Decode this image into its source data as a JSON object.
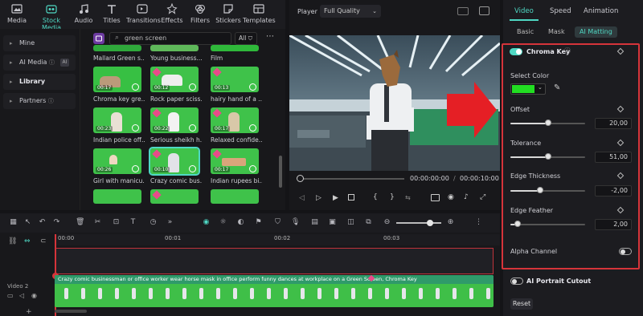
{
  "toolbar": {
    "items": [
      {
        "label": "Media",
        "icon": "media-icon"
      },
      {
        "label": "Stock Media",
        "icon": "stock-media-icon",
        "active": true
      },
      {
        "label": "Audio",
        "icon": "audio-icon"
      },
      {
        "label": "Titles",
        "icon": "titles-icon"
      },
      {
        "label": "Transitions",
        "icon": "transitions-icon"
      },
      {
        "label": "Effects",
        "icon": "effects-icon"
      },
      {
        "label": "Filters",
        "icon": "filters-icon"
      },
      {
        "label": "Stickers",
        "icon": "stickers-icon"
      },
      {
        "label": "Templates",
        "icon": "templates-icon"
      }
    ]
  },
  "leftnav": {
    "items": [
      {
        "label": "Mine"
      },
      {
        "label": "AI Media",
        "badge": "AI"
      },
      {
        "label": "Library"
      },
      {
        "label": "Partners"
      }
    ]
  },
  "media": {
    "search_placeholder": "green screen",
    "filter_label": "All",
    "row0": [
      "Mallard Green s...",
      "Young business...",
      "Film"
    ],
    "items": [
      {
        "caption": "Chroma key gre...",
        "duration": "00:17"
      },
      {
        "caption": "Rock paper sciss...",
        "duration": "00:12"
      },
      {
        "caption": "hairy hand of a ...",
        "duration": "00:13"
      },
      {
        "caption": "Indian police off...",
        "duration": "00:23"
      },
      {
        "caption": "Serious sheikh h...",
        "duration": "00:22"
      },
      {
        "caption": "Relaxed confide...",
        "duration": "00:17"
      },
      {
        "caption": "Girl with manicu...",
        "duration": "00:26"
      },
      {
        "caption": "Crazy comic bus...",
        "duration": "00:10"
      },
      {
        "caption": "Indian rupees bi...",
        "duration": "00:17"
      }
    ]
  },
  "player": {
    "label": "Player",
    "quality": "Full Quality",
    "current_time": "00:00:00:00",
    "separator": "/",
    "total_time": "00:00:10:00"
  },
  "rpanel": {
    "tabs": [
      "Video",
      "Speed",
      "Animation"
    ],
    "subtabs": [
      "Basic",
      "Mask",
      "AI Matting"
    ],
    "chroma_key": "Chroma Key",
    "select_color": "Select Color",
    "key_color": "#22dd22",
    "offset": {
      "label": "Offset",
      "value": "20,00",
      "fraction": 0.5
    },
    "tolerance": {
      "label": "Tolerance",
      "value": "51,00",
      "fraction": 0.51
    },
    "edge_thickness": {
      "label": "Edge Thickness",
      "value": "-2,00",
      "fraction": 0.4
    },
    "edge_feather": {
      "label": "Edge Feather",
      "value": "2,00",
      "fraction": 0.1
    },
    "alpha_channel": "Alpha Channel",
    "ai_portrait": "AI Portrait Cutout",
    "reset": "Reset"
  },
  "timeline": {
    "ruler": [
      "00:00",
      "00:01",
      "00:02",
      "00:03"
    ],
    "track_label": "Video 2",
    "clip_title": "Crazy comic businessman or office worker wear horse mask in office perform funny dances at workplace on a Green Screen, Chroma Key"
  },
  "colors": {
    "accent": "#4fd8c4",
    "highlight": "#d6343a",
    "green": "#3fc24a"
  }
}
